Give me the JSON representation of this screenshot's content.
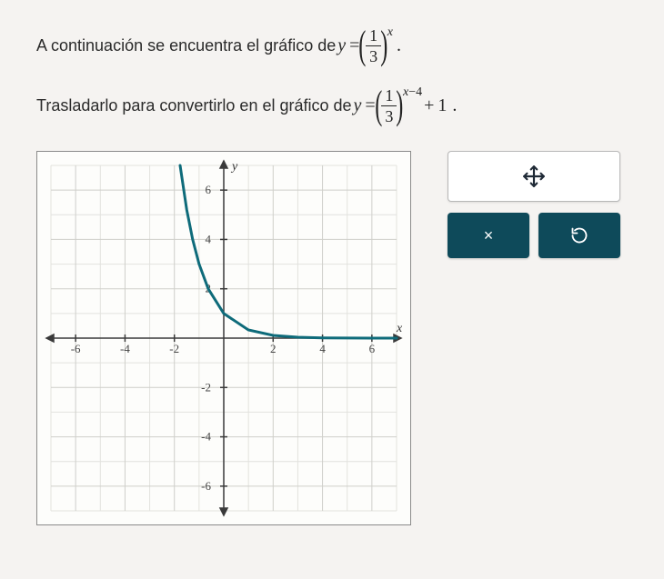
{
  "question": {
    "line1_prefix": "A continuación se encuentra el gráfico de ",
    "line2_prefix": "Trasladarlo para convertirlo en el gráfico de ",
    "eq_lhs": "y",
    "eq_eq": "=",
    "frac_num": "1",
    "frac_den": "3",
    "exp1": "x",
    "exp2_a": "x",
    "exp2_op": "−",
    "exp2_b": "4",
    "tail2_plus": "+",
    "tail2_one": "1",
    "period": "."
  },
  "axis": {
    "x_label": "x",
    "y_label": "y",
    "ticks_x": [
      "-6",
      "-4",
      "-2",
      "2",
      "4",
      "6"
    ],
    "ticks_y_pos": [
      "2",
      "4",
      "6"
    ],
    "ticks_y_neg": [
      "-2",
      "-4",
      "-6"
    ]
  },
  "tools": {
    "move_label": "move-tool",
    "close_label": "×",
    "undo_label": "↺"
  },
  "chart_data": {
    "type": "line",
    "title": "",
    "xlabel": "x",
    "ylabel": "y",
    "xlim": [
      -7,
      7
    ],
    "ylim": [
      -7,
      7
    ],
    "grid": true,
    "series": [
      {
        "name": "y = (1/3)^x",
        "color": "#0e6b7a",
        "x": [
          -1.77,
          -1.5,
          -1.26,
          -1,
          -0.63,
          0,
          1,
          2,
          3,
          4,
          5,
          6,
          7
        ],
        "y": [
          7,
          5.2,
          4,
          3,
          2,
          1,
          0.333,
          0.111,
          0.037,
          0.012,
          0.004,
          0.001,
          0.0005
        ]
      }
    ],
    "target_transform": {
      "dx": 4,
      "dy": 1,
      "description": "shift right 4, up 1"
    }
  }
}
